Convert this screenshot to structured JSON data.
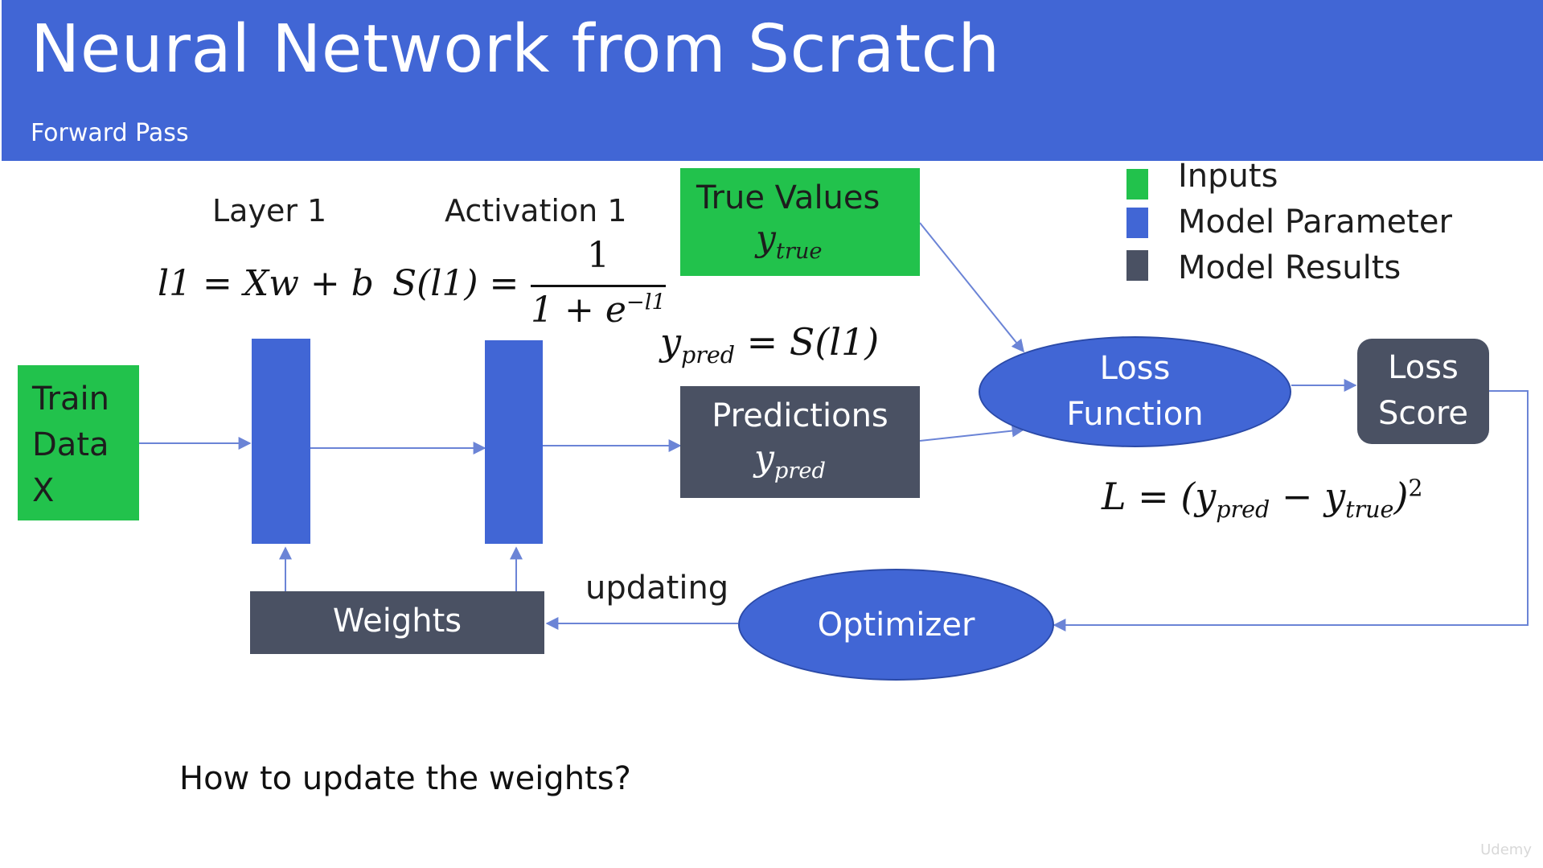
{
  "header": {
    "title": "Neural Network from Scratch",
    "subtitle": "Forward Pass"
  },
  "nodes": {
    "train_data": "Train\nData\nX",
    "layer1_label": "Layer 1",
    "activation1_label": "Activation 1",
    "true_values": "True Values",
    "y_true": "y",
    "y_true_sub": "true",
    "predictions": "Predictions",
    "y_pred": "y",
    "y_pred_sub": "pred",
    "loss_function": "Loss\nFunction",
    "loss_score": "Loss\nScore",
    "weights": "Weights",
    "optimizer": "Optimizer",
    "updating": "updating"
  },
  "legend": [
    {
      "label": "Inputs",
      "color": "#22c24c"
    },
    {
      "label": "Model Parameter",
      "color": "#4166d5"
    },
    {
      "label": "Model Results",
      "color": "#4a5163"
    }
  ],
  "formulas": {
    "layer": "l1 = Xw + b",
    "sigmoid_lhs": "S(l1) =",
    "sigmoid_num": "1",
    "sigmoid_den_base": "1 + e",
    "sigmoid_den_exp": "−l1",
    "ypred_def_lhs": "y",
    "ypred_def_sub": "pred",
    "ypred_def_rhs": " = S(l1)",
    "loss_lhs": "L = (",
    "loss_a": "y",
    "loss_a_sub": "pred",
    "loss_minus": " − ",
    "loss_b": "y",
    "loss_b_sub": "true",
    "loss_close": ")",
    "loss_exp": "2"
  },
  "footer": {
    "question": "How to update the weights?",
    "watermark": "Udemy"
  },
  "colors": {
    "header": "#4166d5",
    "input": "#22c24c",
    "parameter": "#4166d5",
    "result": "#4a5163",
    "arrow": "#6b84d6"
  }
}
